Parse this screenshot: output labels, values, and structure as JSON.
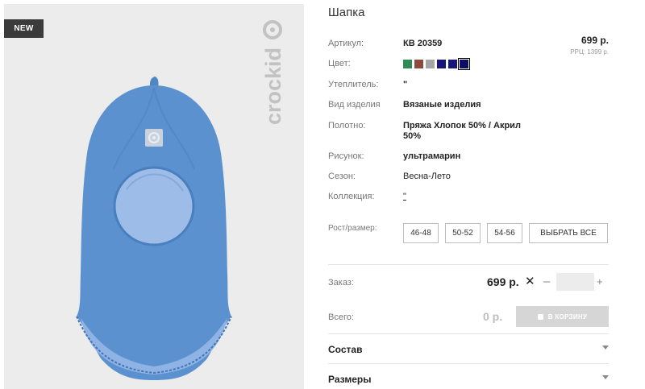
{
  "badge": "NEW",
  "brand": "crockid",
  "title": "Шапка",
  "article": {
    "label": "Артикул:",
    "value": "КВ 20359"
  },
  "price": {
    "value": "699 р.",
    "rrc": "РРЦ: 1399 р."
  },
  "color": {
    "label": "Цвет:",
    "swatches": [
      "#2e8b57",
      "#8b4a3c",
      "#a5a5a5",
      "#16167a",
      "#16167a",
      "#0d0d66"
    ],
    "selected_index": 5
  },
  "insulation": {
    "label": "Утеплитель:",
    "value": "\""
  },
  "product_type": {
    "label": "Вид изделия",
    "value": "Вязаные изделия"
  },
  "fabric": {
    "label": "Полотно:",
    "value": "Пряжа Хлопок 50% / Акрил 50%"
  },
  "pattern": {
    "label": "Рисунок:",
    "value": "ультрамарин"
  },
  "season": {
    "label": "Сезон:",
    "value": "Весна-Лето"
  },
  "collection": {
    "label": "Коллекция:",
    "value": "\""
  },
  "sizes": {
    "label": "Рост/размер:",
    "options": [
      "46-48",
      "50-52",
      "54-56"
    ],
    "select_all": "ВЫБРАТЬ ВСЕ"
  },
  "order": {
    "label": "Заказ:",
    "price": "699 р.",
    "times": "✕",
    "minus": "–",
    "quantity": "",
    "plus": "+"
  },
  "total": {
    "label": "Всего:",
    "value": "0 р.",
    "cart_button": "В КОРЗИНУ"
  },
  "accordions": {
    "composition": "Состав",
    "sizes": "Размеры"
  }
}
